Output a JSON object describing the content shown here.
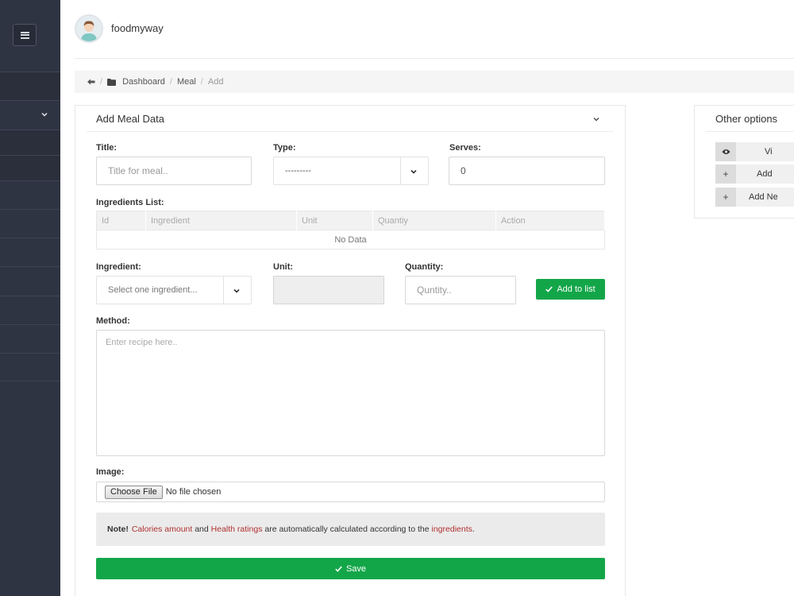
{
  "header": {
    "brand": "foodmyway"
  },
  "breadcrumb": {
    "items": [
      "Dashboard",
      "Meal",
      "Add"
    ]
  },
  "card": {
    "title": "Add Meal Data"
  },
  "form": {
    "title_label": "Title:",
    "title_placeholder": "Title for meal..",
    "type_label": "Type:",
    "type_value": "---------",
    "serves_label": "Serves:",
    "serves_value": "0",
    "ingredients_label": "Ingredients List:",
    "table": {
      "headers": [
        "Id",
        "Ingredient",
        "Unit",
        "Quantiy",
        "Action"
      ],
      "empty": "No Data"
    },
    "ingredient_label": "Ingredient:",
    "ingredient_placeholder": "Select one ingredient...",
    "unit_label": "Unit:",
    "quantity_label": "Quantity:",
    "quantity_placeholder": "Quntity..",
    "add_to_list": "Add to list",
    "method_label": "Method:",
    "method_placeholder": "Enter recipe here..",
    "image_label": "Image:",
    "choose_file": "Choose File",
    "no_file": "No file chosen",
    "note": {
      "strong": "Note!",
      "calories": "Calories amount",
      "and": " and ",
      "health": "Health ratings",
      "middle": " are automatically calculated according to the ",
      "ingredients": "ingredients",
      "end": "."
    },
    "save": "Save"
  },
  "side": {
    "title": "Other options",
    "options": [
      {
        "icon": "eye-icon",
        "label": "Vi"
      },
      {
        "icon": "plus-icon",
        "label": "Add"
      },
      {
        "icon": "plus-icon",
        "label": "Add Ne"
      }
    ]
  },
  "colors": {
    "sidebar": "#2e3442",
    "primary": "#13a649",
    "note_red": "#b03030"
  }
}
